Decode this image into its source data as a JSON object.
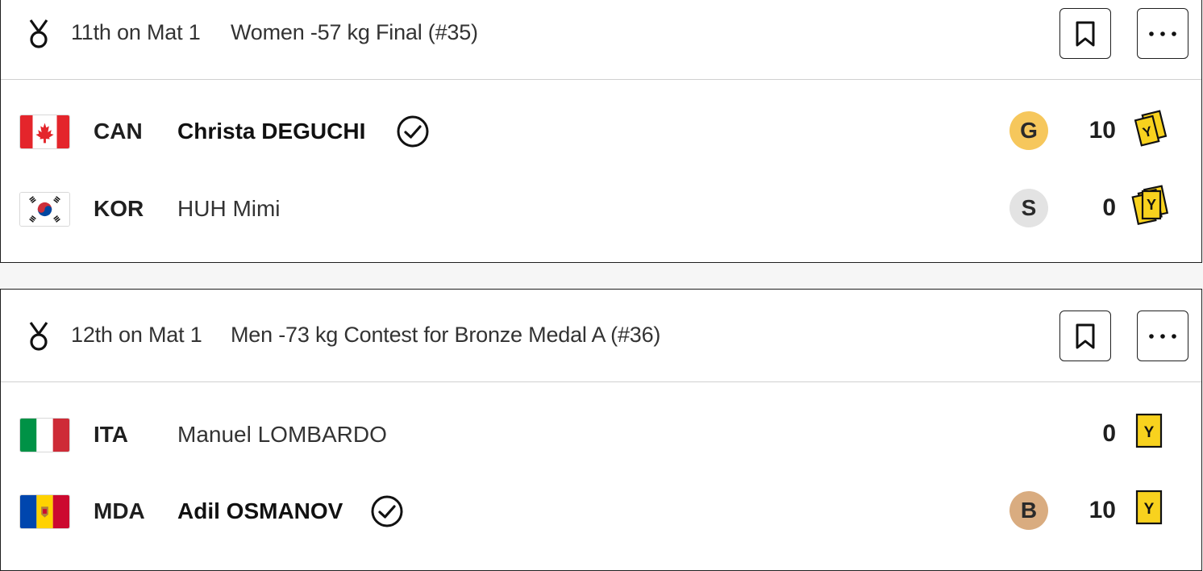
{
  "contests": [
    {
      "position": "11th on Mat 1",
      "title": "Women -57 kg Final (#35)",
      "athletes": [
        {
          "country": "CAN",
          "name": "Christa DEGUCHI",
          "winner": true,
          "medal": "G",
          "medal_color": "#f6c75c",
          "score": "10",
          "penalty": "Y",
          "penalty_count": 2
        },
        {
          "country": "KOR",
          "name": "HUH Mimi",
          "winner": false,
          "medal": "S",
          "medal_color": "#e3e3e3",
          "score": "0",
          "penalty": "Y",
          "penalty_count": 3
        }
      ]
    },
    {
      "position": "12th on Mat 1",
      "title": "Men -73 kg Contest for Bronze Medal A (#36)",
      "athletes": [
        {
          "country": "ITA",
          "name": "Manuel LOMBARDO",
          "winner": false,
          "score": "0",
          "penalty": "Y",
          "penalty_count": 1
        },
        {
          "country": "MDA",
          "name": "Adil OSMANOV",
          "winner": true,
          "medal": "B",
          "medal_color": "#d9ac80",
          "score": "10",
          "penalty": "Y",
          "penalty_count": 1
        }
      ]
    }
  ],
  "icons": {
    "event": "medal-icon",
    "bookmark": "bookmark-icon",
    "more": "more-options-icon",
    "winner": "check-circle-icon"
  },
  "colors": {
    "penalty_yellow": "#f8d21e",
    "gold": "#f6c75c",
    "silver": "#e3e3e3",
    "bronze": "#d9ac80"
  }
}
